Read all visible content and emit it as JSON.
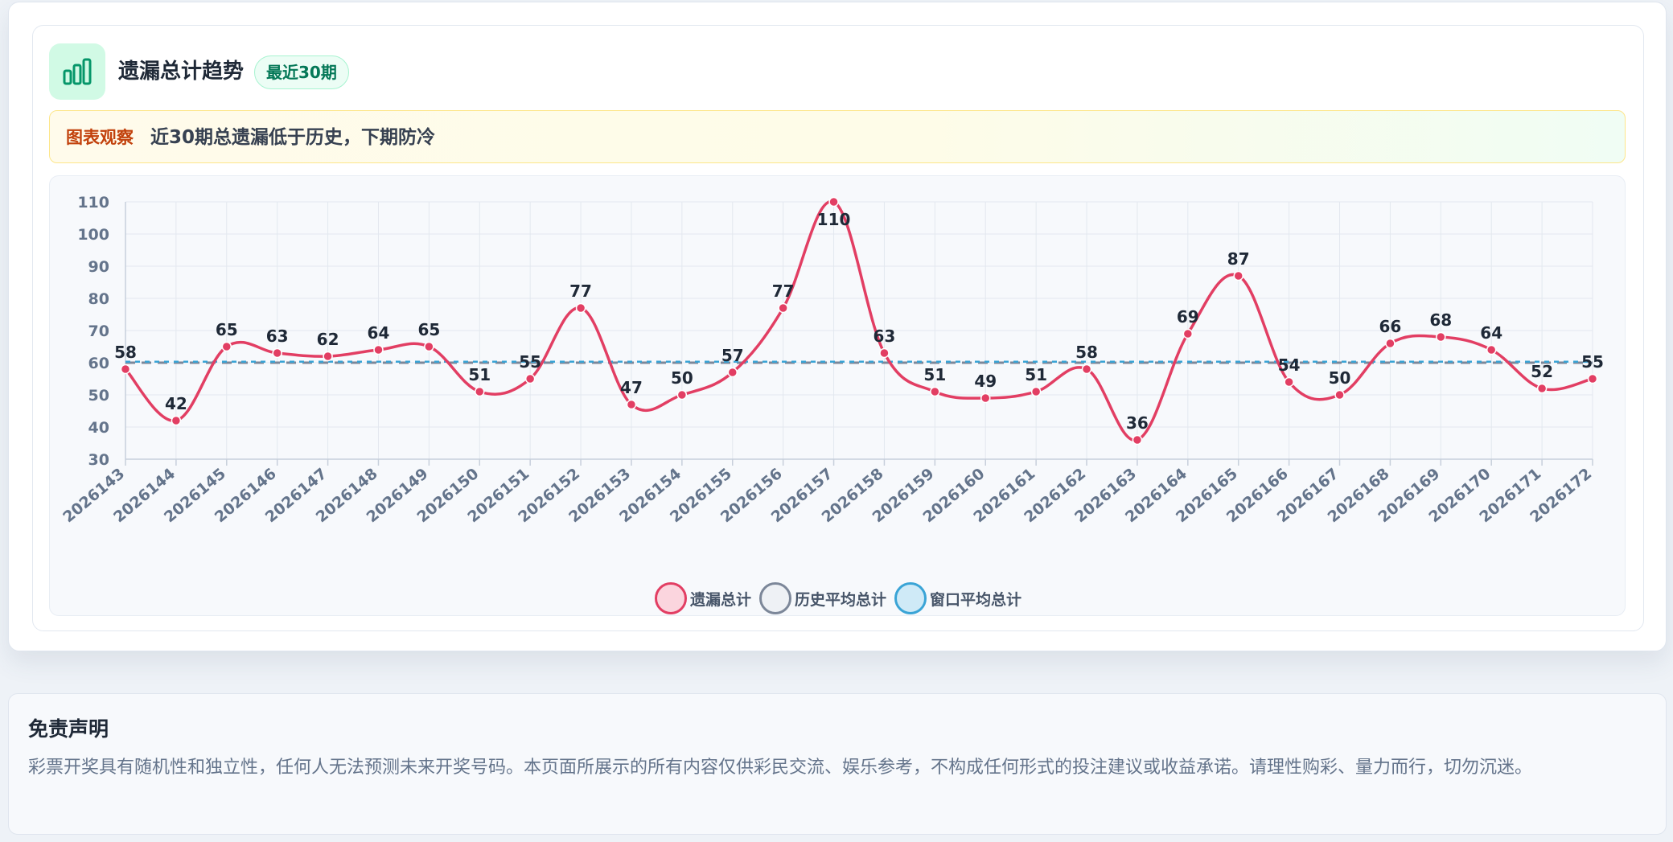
{
  "card": {
    "title": "遗漏总计趋势",
    "badge": "最近30期",
    "icon": "bar-chart-icon",
    "observation_label": "图表观察",
    "observation_text": "近30期总遗漏低于历史，下期防冷"
  },
  "colors": {
    "main_line": "#e23e63",
    "history_avg": "#7c8799",
    "window_avg": "#3aa4d6",
    "accent_green": "#059669"
  },
  "chart_data": {
    "type": "line",
    "categories": [
      "2026143",
      "2026144",
      "2026145",
      "2026146",
      "2026147",
      "2026148",
      "2026149",
      "2026150",
      "2026151",
      "2026152",
      "2026153",
      "2026154",
      "2026155",
      "2026156",
      "2026157",
      "2026158",
      "2026159",
      "2026160",
      "2026161",
      "2026162",
      "2026163",
      "2026164",
      "2026165",
      "2026166",
      "2026167",
      "2026168",
      "2026169",
      "2026170",
      "2026171",
      "2026172"
    ],
    "series": [
      {
        "name": "遗漏总计",
        "values": [
          58,
          42,
          65,
          63,
          62,
          64,
          65,
          51,
          55,
          77,
          47,
          50,
          57,
          77,
          110,
          63,
          51,
          49,
          51,
          58,
          36,
          69,
          87,
          54,
          50,
          66,
          68,
          64,
          52,
          55
        ],
        "color": "#e23e63",
        "style": "smooth"
      },
      {
        "name": "历史平均总计",
        "values": [
          60,
          60,
          60,
          60,
          60,
          60,
          60,
          60,
          60,
          60,
          60,
          60,
          60,
          60,
          60,
          60,
          60,
          60,
          60,
          60,
          60,
          60,
          60,
          60,
          60,
          60,
          60,
          60,
          60,
          60
        ],
        "color": "#7c8799",
        "style": "dashed"
      },
      {
        "name": "窗口平均总计",
        "values": [
          60.3,
          60.3,
          60.3,
          60.3,
          60.3,
          60.3,
          60.3,
          60.3,
          60.3,
          60.3,
          60.3,
          60.3,
          60.3,
          60.3,
          60.3,
          60.3,
          60.3,
          60.3,
          60.3,
          60.3,
          60.3,
          60.3,
          60.3,
          60.3,
          60.3,
          60.3,
          60.3,
          60.3,
          60.3,
          60.3
        ],
        "color": "#3aa4d6",
        "style": "dashed"
      }
    ],
    "yticks": [
      30,
      40,
      50,
      60,
      70,
      80,
      90,
      100,
      110
    ],
    "ylim": [
      30,
      110
    ],
    "grid": true,
    "legend": "bottom-center",
    "data_labels": true
  },
  "disclaimer": {
    "title": "免责声明",
    "body": "彩票开奖具有随机性和独立性，任何人无法预测未来开奖号码。本页面所展示的所有内容仅供彩民交流、娱乐参考，不构成任何形式的投注建议或收益承诺。请理性购彩、量力而行，切勿沉迷。"
  }
}
